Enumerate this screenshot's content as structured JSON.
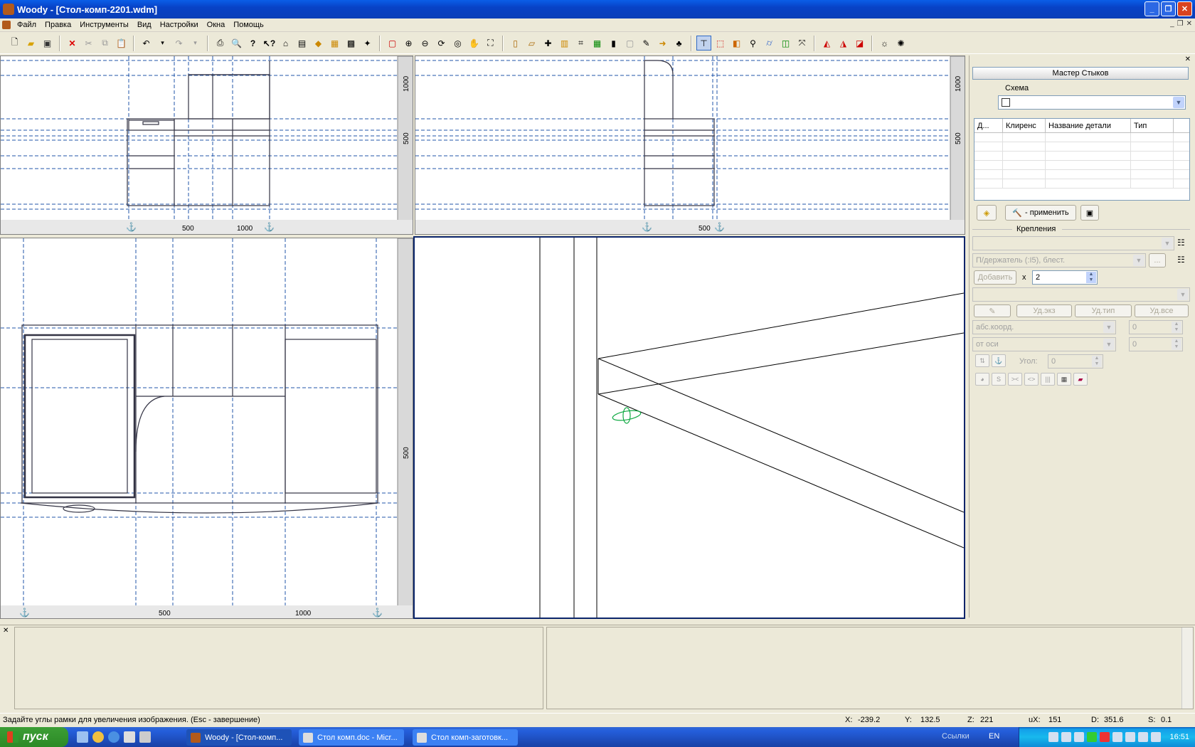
{
  "window": {
    "title": "Woody - [Стол-комп-2201.wdm]"
  },
  "menu": [
    "Файл",
    "Правка",
    "Инструменты",
    "Вид",
    "Настройки",
    "Окна",
    "Помощь"
  ],
  "views": {
    "front_ticks": [
      "1000",
      "500"
    ],
    "front_bottom": [
      "500",
      "1000"
    ],
    "side_ticks": [
      "1000",
      "500"
    ],
    "side_bottom": [
      "500"
    ],
    "top_ticks": [
      "500"
    ],
    "top_bottom": [
      "500",
      "1000"
    ]
  },
  "panel": {
    "header": "Мастер Стыков",
    "scheme_label": "Схема",
    "columns": [
      "Д...",
      "Клиренс",
      "Название детали",
      "Тип"
    ],
    "apply_button": "- применить",
    "fasteners_label": "Крепления",
    "fastener_value": "П/держатель (:I5), блест.",
    "add_button": "Добавить",
    "times": "x",
    "count": "2",
    "del_copy": "Уд.экз",
    "del_type": "Уд.тип",
    "del_all": "Уд.все",
    "abs_coord": "абс.коорд.",
    "from_axis": "от оси",
    "val1": "0",
    "val2": "0",
    "angle_label": "Угол:",
    "angle_value": "0"
  },
  "status": {
    "message": "Задайте углы рамки для увеличения изображения. (Esc - завершение)",
    "x_label": "X:",
    "x": "-239.2",
    "y_label": "Y:",
    "y": "132.5",
    "z_label": "Z:",
    "z": "221",
    "ux_label": "uX:",
    "ux": "151",
    "d_label": "D:",
    "d": "351.6",
    "s_label": "S:",
    "s": "0.1"
  },
  "taskbar": {
    "start": "пуск",
    "tasks": [
      "Woody - [Стол-комп...",
      "Стол комп.doc - Micr...",
      "Стол комп-заготовк..."
    ],
    "links": "Ссылки",
    "lang": "EN",
    "clock": "16:51"
  }
}
